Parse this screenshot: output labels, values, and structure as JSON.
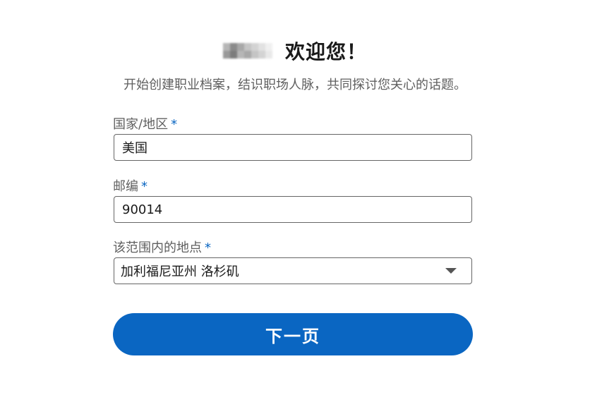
{
  "header": {
    "greeting": "欢迎您！",
    "subtitle": "开始创建职业档案，结识职场人脉，共同探讨您关心的话题。"
  },
  "form": {
    "country": {
      "label": "国家/地区",
      "required_mark": "*",
      "value": "美国"
    },
    "zip": {
      "label": "邮编",
      "required_mark": "*",
      "value": "90014"
    },
    "location": {
      "label": "该范围内的地点",
      "required_mark": "*",
      "value": "加利福尼亚州 洛杉矶"
    }
  },
  "actions": {
    "next_label": "下一页"
  },
  "colors": {
    "accent": "#0a66c2",
    "label_text": "#5f5f5f",
    "border": "#666666"
  },
  "icons": {
    "dropdown": "chevron-down-icon"
  }
}
